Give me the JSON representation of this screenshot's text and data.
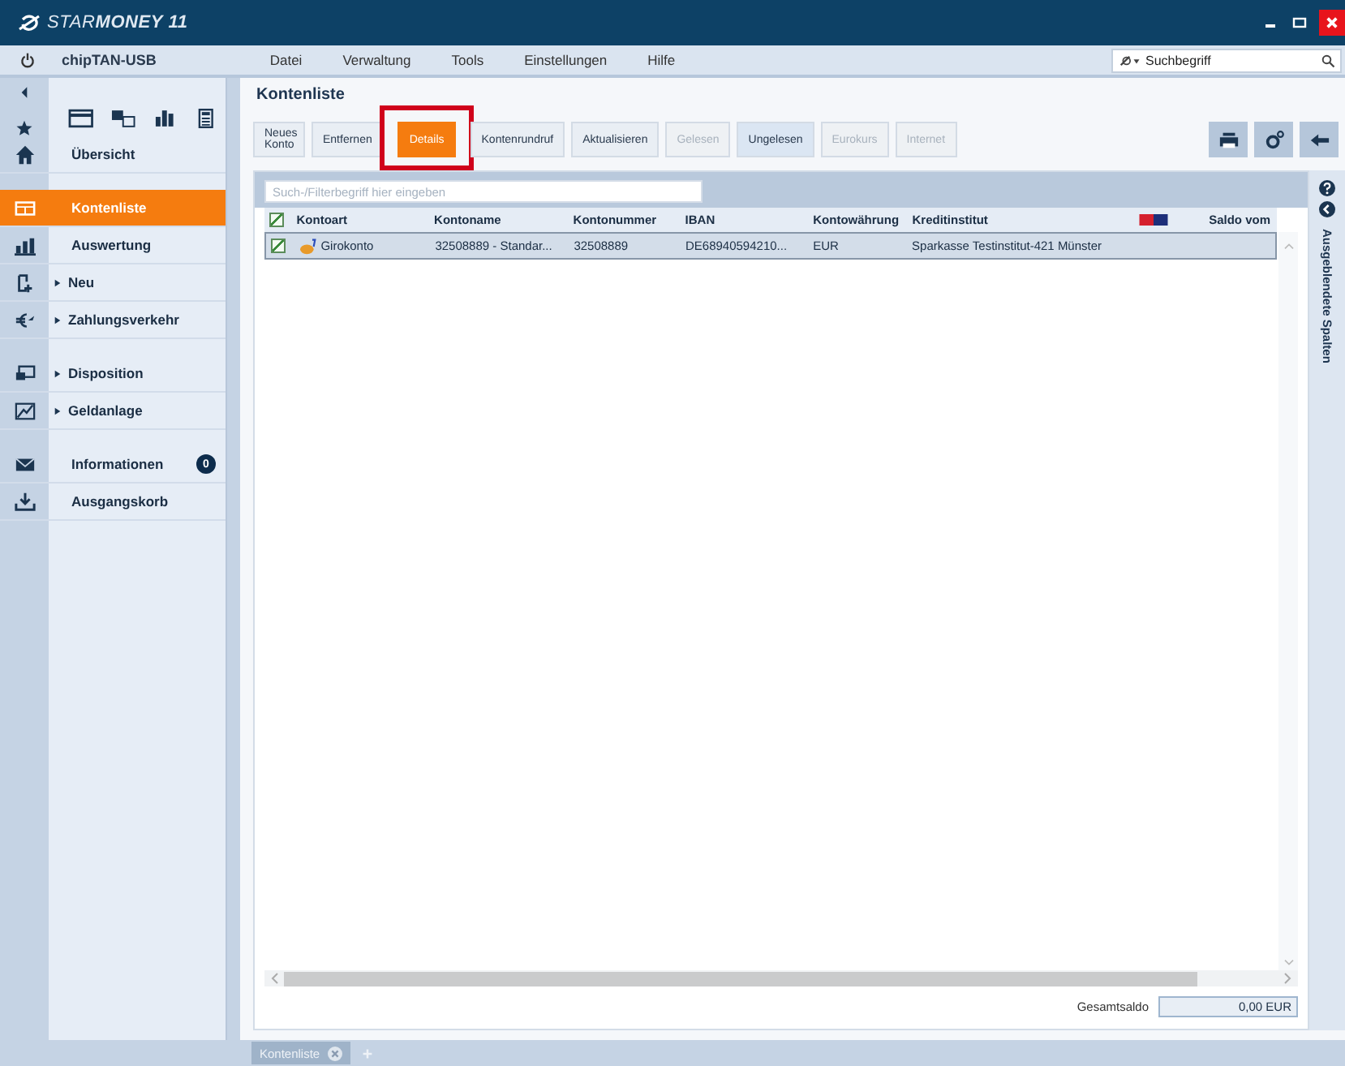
{
  "window": {
    "title": "STAR**MONEY 11**"
  },
  "menu_bar": {
    "profile": "chipTAN-USB",
    "menus": [
      "Datei",
      "Verwaltung",
      "Tools",
      "Einstellungen",
      "Hilfe"
    ],
    "search": {
      "placeholder": "Suchbegriff"
    }
  },
  "sidebar": {
    "items": [
      {
        "label": "Übersicht",
        "selected": false,
        "expandable": false,
        "kind": "home"
      },
      {
        "label": "Kontenliste",
        "selected": true,
        "expandable": false,
        "kind": "list"
      },
      {
        "label": "Auswertung",
        "selected": false,
        "expandable": false,
        "kind": "chart"
      },
      {
        "label": "Neu",
        "selected": false,
        "expandable": true,
        "kind": "new"
      },
      {
        "label": "Zahlungsverkehr",
        "selected": false,
        "expandable": true,
        "kind": "euro"
      },
      {
        "label": "Disposition",
        "selected": false,
        "expandable": true,
        "kind": "dispo"
      },
      {
        "label": "Geldanlage",
        "selected": false,
        "expandable": true,
        "kind": "invest"
      },
      {
        "label": "Informationen",
        "selected": false,
        "expandable": false,
        "kind": "mail",
        "badge": "0"
      },
      {
        "label": "Ausgangskorb",
        "selected": false,
        "expandable": false,
        "kind": "outbox"
      }
    ]
  },
  "page": {
    "title": "Kontenliste"
  },
  "toolbar": [
    {
      "label": "Neues Konto",
      "selected": false,
      "disabled": false
    },
    {
      "label": "Entfernen",
      "selected": false,
      "disabled": false
    },
    {
      "label": "Details",
      "selected": true,
      "disabled": false,
      "highlighted": true
    },
    {
      "label": "Kontenrundruf",
      "selected": false,
      "disabled": false
    },
    {
      "label": "Aktualisieren",
      "selected": false,
      "disabled": false
    },
    {
      "label": "Gelesen",
      "selected": false,
      "disabled": true
    },
    {
      "label": "Ungelesen",
      "selected": false,
      "disabled": false
    },
    {
      "label": "Eurokurs",
      "selected": false,
      "disabled": true
    },
    {
      "label": "Internet",
      "selected": false,
      "disabled": true
    }
  ],
  "filter": {
    "placeholder": "Such-/Filterbegriff hier eingeben"
  },
  "table": {
    "all_checked": true,
    "columns": [
      "Kontoart",
      "Kontoname",
      "Kontonummer",
      "IBAN",
      "Kontowährung",
      "Kreditinstitut",
      "",
      "Saldo vom"
    ],
    "rows": [
      {
        "checked": true,
        "selected": true,
        "cells": [
          "Girokonto",
          "32508889 - Standar...",
          "32508889",
          "DE68940594210...",
          "EUR",
          "Sparkasse Testinstitut-421 Münster",
          "",
          ""
        ]
      }
    ]
  },
  "hidden_columns": {
    "label": "Ausgeblendete Spalten"
  },
  "footer": {
    "label": "Gesamtsaldo",
    "value": "0,00 EUR"
  },
  "tabs": [
    {
      "label": "Kontenliste",
      "selected": true
    }
  ]
}
